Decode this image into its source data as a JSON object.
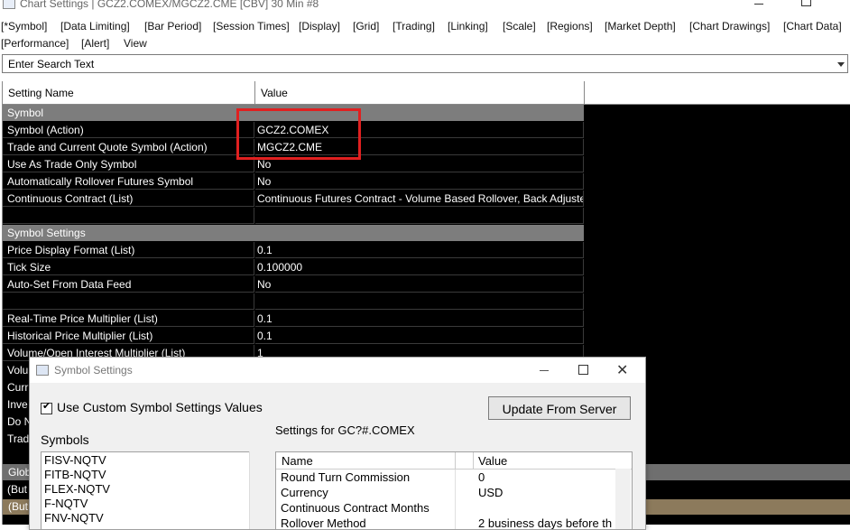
{
  "window": {
    "title": "Chart Settings | GCZ2.COMEX/MGCZ2.CME [CBV]  30 Min   #8"
  },
  "menu": {
    "tabs": [
      "[*Symbol]",
      "[Data Limiting]",
      "[Bar Period]",
      "[Session Times]",
      "[Display]",
      "[Grid]",
      "[Trading]",
      "[Linking]",
      "[Scale]",
      "[Regions]",
      "[Market Depth]",
      "[Chart Drawings]",
      "[Chart Data]",
      "[Performance]",
      "[Alert]",
      "View"
    ]
  },
  "search": {
    "value": "Enter Search Text"
  },
  "grid": {
    "header": {
      "name": "Setting Name",
      "value": "Value"
    },
    "groups": {
      "symbol": "Symbol",
      "symbol_settings": "Symbol Settings"
    },
    "rows": [
      {
        "name": "Symbol (Action)",
        "value": "GCZ2.COMEX"
      },
      {
        "name": "Trade and Current Quote Symbol (Action)",
        "value": "MGCZ2.CME"
      },
      {
        "name": "Use As Trade Only Symbol",
        "value": "No"
      },
      {
        "name": "Automatically Rollover Futures Symbol",
        "value": "No"
      },
      {
        "name": "Continuous Contract (List)",
        "value": "Continuous Futures Contract - Volume Based Rollover, Back Adjusted"
      },
      {
        "name": "Price Display Format (List)",
        "value": "0.1"
      },
      {
        "name": "Tick Size",
        "value": "0.100000"
      },
      {
        "name": "Auto-Set From Data Feed",
        "value": "No"
      },
      {
        "name": "Real-Time Price Multiplier (List)",
        "value": "0.1"
      },
      {
        "name": "Historical Price Multiplier (List)",
        "value": "0.1"
      },
      {
        "name": "Volume/Open Interest Multiplier (List)",
        "value": "1"
      }
    ],
    "partial_rows": [
      "Volu",
      "Curr",
      "Inve",
      "Do N",
      "Trad"
    ],
    "bottom_bars": [
      "Glob",
      "(But",
      "(But"
    ]
  },
  "dialog": {
    "title": "Symbol Settings",
    "checkbox_label": "Use Custom Symbol Settings Values",
    "checkbox_checked": true,
    "checkbox_mark": "✔",
    "close_glyph": "✕",
    "update_button": "Update From Server",
    "symbols_label": "Symbols",
    "settings_for": "Settings for GC?#.COMEX",
    "symbols": [
      "FISV-NQTV",
      "FITB-NQTV",
      "FLEX-NQTV",
      "F-NQTV",
      "FNV-NQTV"
    ],
    "table": {
      "header": {
        "name": "Name",
        "value": "Value"
      },
      "rows": [
        {
          "name": "Round Turn Commission",
          "value": "0"
        },
        {
          "name": "Currency",
          "value": "USD"
        },
        {
          "name": "Continuous Contract Months",
          "value": ""
        },
        {
          "name": "Rollover Method",
          "value": "2 business days before th"
        }
      ]
    }
  },
  "colors": {
    "grid_bg": "#000000",
    "group_header": "#7d7d7d",
    "highlight": "#e02020",
    "tan_bar": "#8c7a5c"
  }
}
